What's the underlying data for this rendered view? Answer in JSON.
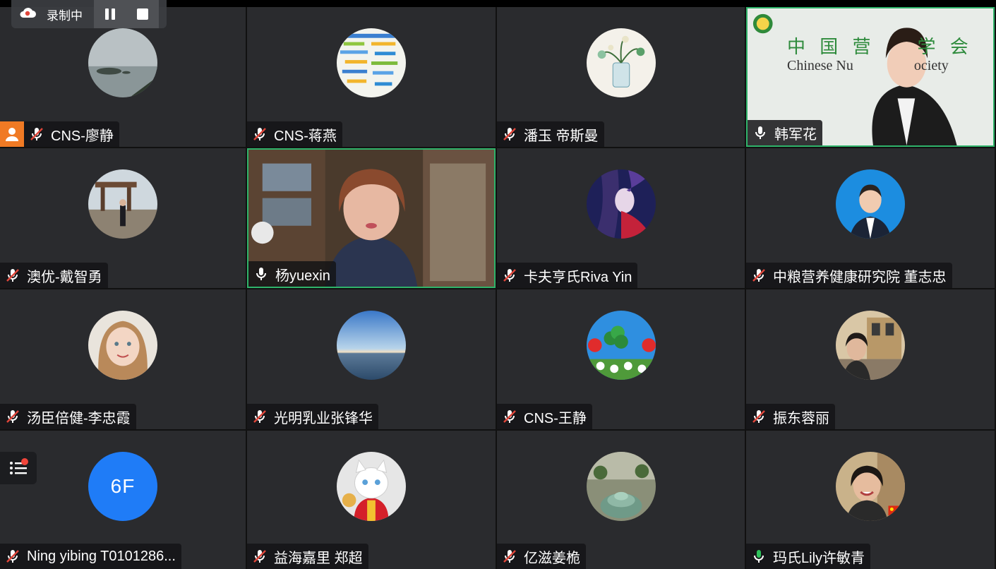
{
  "recording": {
    "label": "录制中",
    "pause_icon": "pause-icon",
    "stop_icon": "stop-icon"
  },
  "colors": {
    "tile_bg": "#2a2b2e",
    "active_border": "#2fb36a",
    "host_badge": "#f07a24",
    "muted_mic": "#e0453a",
    "initials_avatar": "#1f7cf7"
  },
  "participants": [
    {
      "name": "CNS-廖静",
      "mic": "muted",
      "host": true
    },
    {
      "name": "CNS-蒋燕",
      "mic": "muted"
    },
    {
      "name": "潘玉 帝斯曼",
      "mic": "muted"
    },
    {
      "name": "韩军花",
      "mic": "on",
      "video": true
    },
    {
      "name": "澳优-戴智勇",
      "mic": "muted"
    },
    {
      "name": "杨yuexin",
      "mic": "on",
      "video": true,
      "active_speaker": true
    },
    {
      "name": "卡夫亨氏Riva Yin",
      "mic": "muted"
    },
    {
      "name": "中粮营养健康研究院 董志忠",
      "mic": "muted"
    },
    {
      "name": "汤臣倍健-李忠霞",
      "mic": "muted"
    },
    {
      "name": "光明乳业张锋华",
      "mic": "muted"
    },
    {
      "name": "CNS-王静",
      "mic": "muted"
    },
    {
      "name": "振东蓉丽",
      "mic": "muted"
    },
    {
      "name": "Ning yibing T0101286...",
      "mic": "muted",
      "initials": "6F"
    },
    {
      "name": "益海嘉里 郑超",
      "mic": "muted"
    },
    {
      "name": "亿滋姜桅",
      "mic": "muted"
    },
    {
      "name": "玛氏Lily许敏青",
      "mic": "speaking"
    }
  ],
  "backdrop": {
    "line1": "中 国 营",
    "line1b": "学 会",
    "line2": "Chinese Nu",
    "line2b": "ociety"
  }
}
